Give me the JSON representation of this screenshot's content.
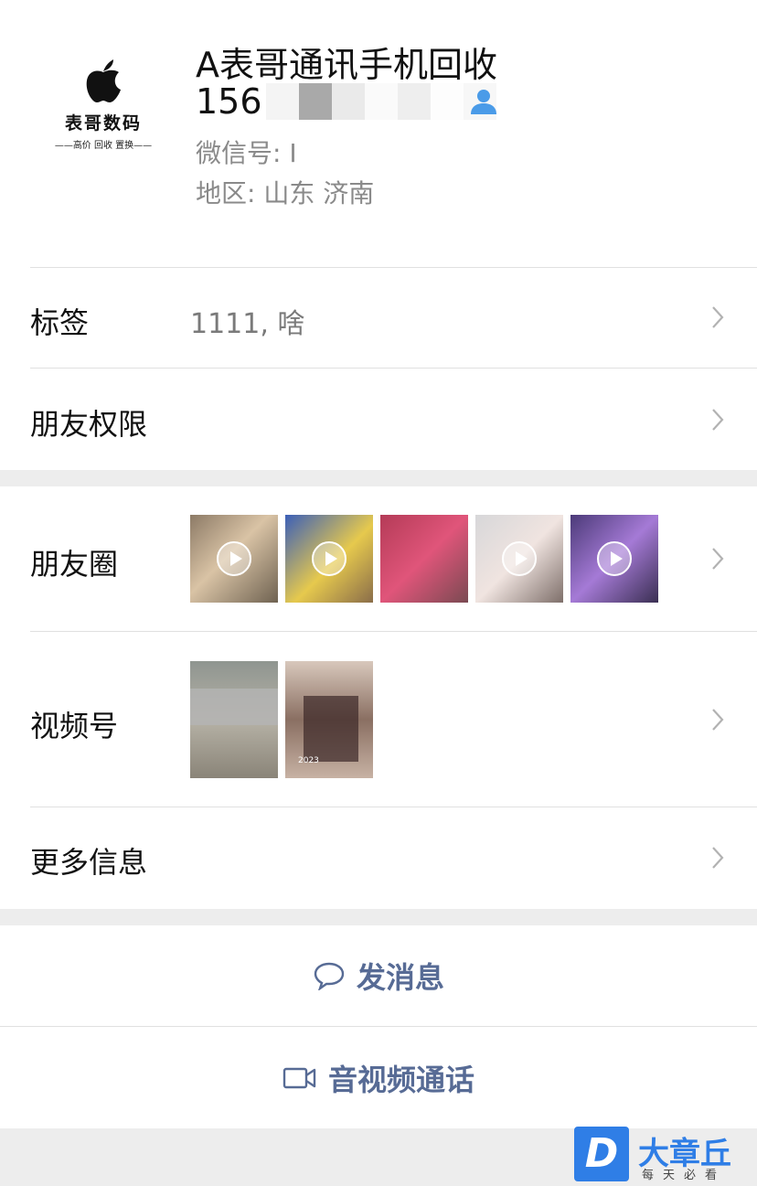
{
  "profile": {
    "avatar_brand": "表哥数码",
    "avatar_slogan": "——高价 回收 置换——",
    "name": "A表哥通讯手机回收",
    "phone_prefix": "156",
    "wechat_id_label": "微信号: ",
    "wechat_id_value": "I",
    "region_label": "地区: ",
    "region_value": "山东 济南"
  },
  "rows": {
    "tags": {
      "label": "标签",
      "value": "1111, 啥"
    },
    "permissions": {
      "label": "朋友权限"
    },
    "moments": {
      "label": "朋友圈"
    },
    "channels": {
      "label": "视频号"
    },
    "more": {
      "label": "更多信息"
    }
  },
  "channels_thumb_caption": "2023",
  "actions": {
    "message": "发消息",
    "call": "音视频通话"
  },
  "watermark": {
    "logo": "D",
    "title": "大章丘",
    "subtitle": "每天必看"
  },
  "colors": {
    "link": "#576b95",
    "contact_icon": "#4a9be8",
    "watermark": "#2f7ee6"
  }
}
